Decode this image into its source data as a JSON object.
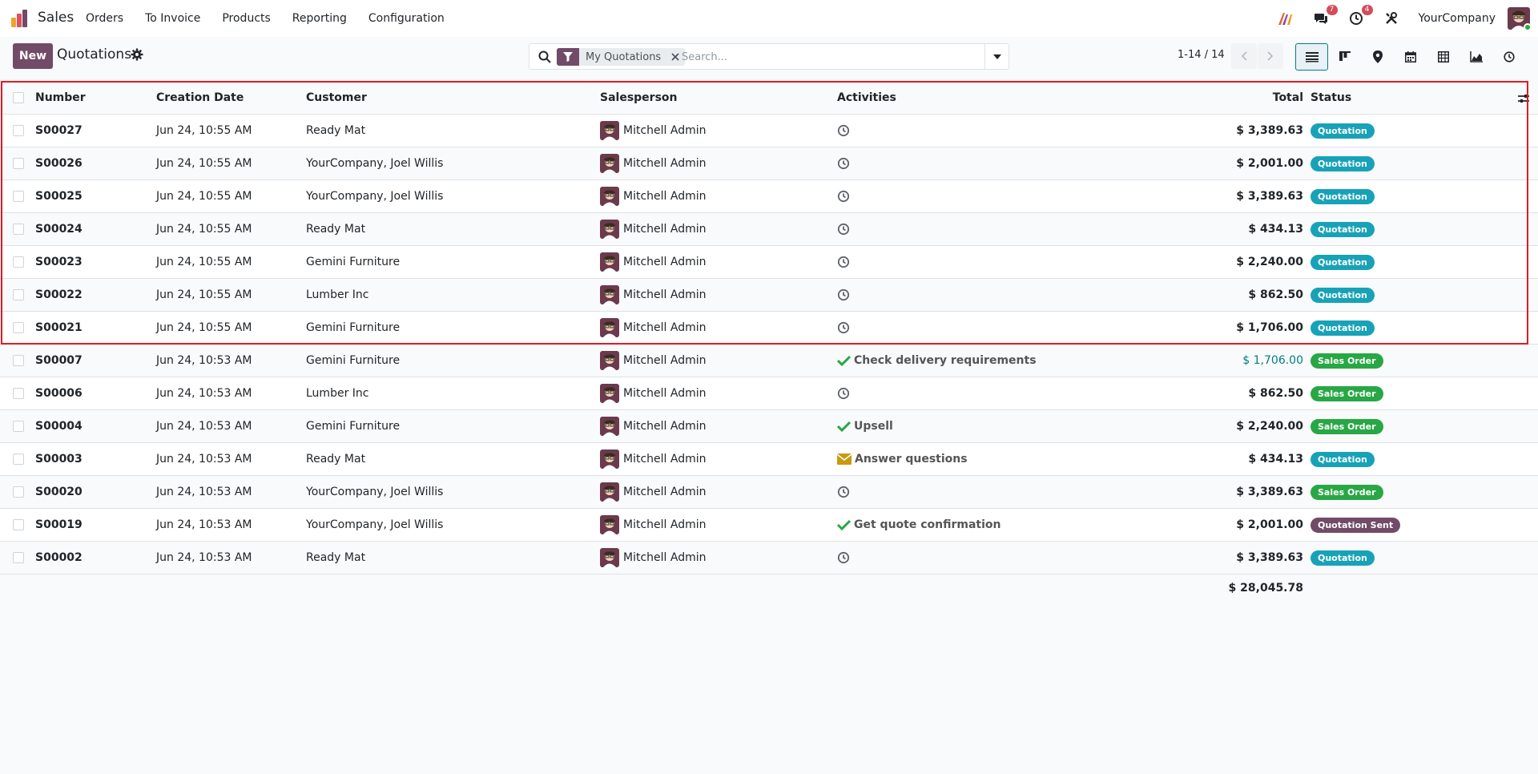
{
  "app": {
    "name": "Sales"
  },
  "menu": [
    "Orders",
    "To Invoice",
    "Products",
    "Reporting",
    "Configuration"
  ],
  "systray": {
    "messages_count": "7",
    "activities_count": "4",
    "company": "YourCompany"
  },
  "control": {
    "new_label": "New",
    "title": "Quotations",
    "facet_label": "My Quotations",
    "search_placeholder": "Search...",
    "pager": "1-14 / 14"
  },
  "columns": {
    "number": "Number",
    "date": "Creation Date",
    "customer": "Customer",
    "salesperson": "Salesperson",
    "activities": "Activities",
    "total": "Total",
    "status": "Status"
  },
  "rows": [
    {
      "number": "S00027",
      "date": "Jun 24, 10:55 AM",
      "customer": "Ready Mat",
      "salesperson": "Mitchell Admin",
      "activity_icon": "clock",
      "activity": "",
      "total": "$ 3,389.63",
      "status": "Quotation"
    },
    {
      "number": "S00026",
      "date": "Jun 24, 10:55 AM",
      "customer": "YourCompany, Joel Willis",
      "salesperson": "Mitchell Admin",
      "activity_icon": "clock",
      "activity": "",
      "total": "$ 2,001.00",
      "status": "Quotation"
    },
    {
      "number": "S00025",
      "date": "Jun 24, 10:55 AM",
      "customer": "YourCompany, Joel Willis",
      "salesperson": "Mitchell Admin",
      "activity_icon": "clock",
      "activity": "",
      "total": "$ 3,389.63",
      "status": "Quotation"
    },
    {
      "number": "S00024",
      "date": "Jun 24, 10:55 AM",
      "customer": "Ready Mat",
      "salesperson": "Mitchell Admin",
      "activity_icon": "clock",
      "activity": "",
      "total": "$ 434.13",
      "status": "Quotation"
    },
    {
      "number": "S00023",
      "date": "Jun 24, 10:55 AM",
      "customer": "Gemini Furniture",
      "salesperson": "Mitchell Admin",
      "activity_icon": "clock",
      "activity": "",
      "total": "$ 2,240.00",
      "status": "Quotation"
    },
    {
      "number": "S00022",
      "date": "Jun 24, 10:55 AM",
      "customer": "Lumber Inc",
      "salesperson": "Mitchell Admin",
      "activity_icon": "clock",
      "activity": "",
      "total": "$ 862.50",
      "status": "Quotation"
    },
    {
      "number": "S00021",
      "date": "Jun 24, 10:55 AM",
      "customer": "Gemini Furniture",
      "salesperson": "Mitchell Admin",
      "activity_icon": "clock",
      "activity": "",
      "total": "$ 1,706.00",
      "status": "Quotation"
    },
    {
      "number": "S00007",
      "date": "Jun 24, 10:53 AM",
      "customer": "Gemini Furniture",
      "salesperson": "Mitchell Admin",
      "activity_icon": "check",
      "activity": "Check delivery requirements",
      "total": "$ 1,706.00",
      "total_color": "#017e84",
      "status": "Sales Order"
    },
    {
      "number": "S00006",
      "date": "Jun 24, 10:53 AM",
      "customer": "Lumber Inc",
      "salesperson": "Mitchell Admin",
      "activity_icon": "clock",
      "activity": "",
      "total": "$ 862.50",
      "status": "Sales Order"
    },
    {
      "number": "S00004",
      "date": "Jun 24, 10:53 AM",
      "customer": "Gemini Furniture",
      "salesperson": "Mitchell Admin",
      "activity_icon": "check",
      "activity": "Upsell",
      "total": "$ 2,240.00",
      "status": "Sales Order"
    },
    {
      "number": "S00003",
      "date": "Jun 24, 10:53 AM",
      "customer": "Ready Mat",
      "salesperson": "Mitchell Admin",
      "activity_icon": "envelope",
      "activity": "Answer questions",
      "total": "$ 434.13",
      "status": "Quotation"
    },
    {
      "number": "S00020",
      "date": "Jun 24, 10:53 AM",
      "customer": "YourCompany, Joel Willis",
      "salesperson": "Mitchell Admin",
      "activity_icon": "clock",
      "activity": "",
      "total": "$ 3,389.63",
      "status": "Sales Order"
    },
    {
      "number": "S00019",
      "date": "Jun 24, 10:53 AM",
      "customer": "YourCompany, Joel Willis",
      "salesperson": "Mitchell Admin",
      "activity_icon": "check",
      "activity": "Get quote confirmation",
      "total": "$ 2,001.00",
      "status": "Quotation Sent"
    },
    {
      "number": "S00002",
      "date": "Jun 24, 10:53 AM",
      "customer": "Ready Mat",
      "salesperson": "Mitchell Admin",
      "activity_icon": "clock",
      "activity": "",
      "total": "$ 3,389.63",
      "status": "Quotation"
    }
  ],
  "footer": {
    "total": "$ 28,045.78"
  },
  "colors": {
    "brand": "#714b67",
    "quotation": "#17a2b8",
    "sales_order": "#28a745",
    "quotation_sent": "#714b67",
    "highlight": "#e01b24"
  }
}
